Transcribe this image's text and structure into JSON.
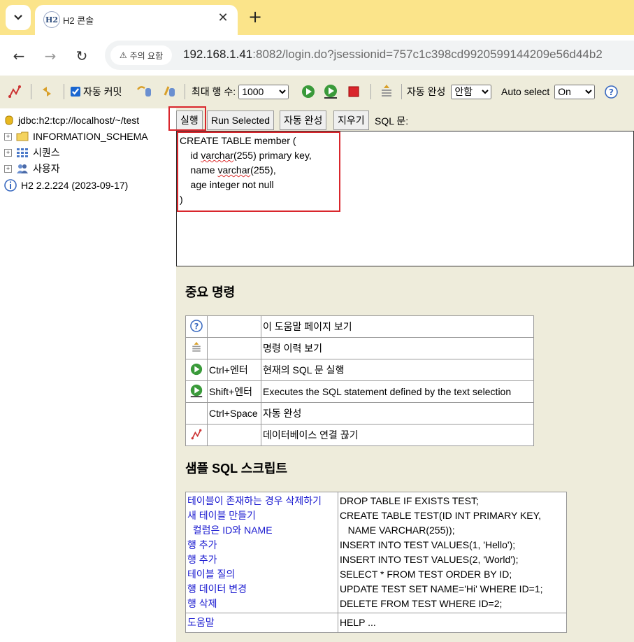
{
  "browser": {
    "tab_title": "H2 콘솔",
    "tab_logo": "H2",
    "security_chip": "주의 요함",
    "url_host": "192.168.1.41",
    "url_rest": ":8082/login.do?jsessionid=757c1c398cd9920599144209e56d44b2"
  },
  "toolbar": {
    "auto_commit_label": "자동 커밋",
    "auto_commit_checked": true,
    "max_rows_label": "최대 행 수:",
    "max_rows_value": "1000",
    "autocomplete_label": "자동 완성",
    "autocomplete_value": "안함",
    "auto_select_label": "Auto select",
    "auto_select_value": "On"
  },
  "tree": {
    "connection": "jdbc:h2:tcp://localhost/~/test",
    "items": [
      "INFORMATION_SCHEMA",
      "시퀀스",
      "사용자"
    ],
    "version": "H2 2.2.224 (2023-09-17)"
  },
  "query": {
    "run_label": "실행",
    "run_selected_label": "Run Selected",
    "autocomplete_label": "자동 완성",
    "clear_label": "지우기",
    "sql_label": "SQL 문:",
    "sql_lines": [
      "CREATE TABLE member (",
      "    id varchar(255) primary key,",
      "    name varchar(255),",
      "    age integer not null",
      ")"
    ]
  },
  "help": {
    "title": "중요 명령",
    "rows": [
      {
        "icon": "help-icon",
        "key": "",
        "desc": "이 도움말 페이지 보기"
      },
      {
        "icon": "history-icon",
        "key": "",
        "desc": "명령 이력 보기"
      },
      {
        "icon": "run-icon",
        "key": "Ctrl+엔터",
        "desc": "현재의 SQL 문 실행"
      },
      {
        "icon": "run-selected-icon",
        "key": "Shift+엔터",
        "desc": "Executes the SQL statement defined by the text selection"
      },
      {
        "icon": "",
        "key": "Ctrl+Space",
        "desc": "자동 완성"
      },
      {
        "icon": "disconnect-icon",
        "key": "",
        "desc": "데이터베이스 연결 끊기"
      }
    ]
  },
  "samples": {
    "title": "샘플 SQL 스크립트",
    "links": [
      "테이블이 존재하는 경우 삭제하기",
      "새 테이블 만들기",
      "  컬럼은 ID와 NAME",
      "행 추가",
      "행 추가",
      "테이블 질의",
      "행 데이터 변경",
      "행 삭제"
    ],
    "code": [
      "DROP TABLE IF EXISTS TEST;",
      "CREATE TABLE TEST(ID INT PRIMARY KEY,",
      "   NAME VARCHAR(255));",
      "INSERT INTO TEST VALUES(1, 'Hello');",
      "INSERT INTO TEST VALUES(2, 'World');",
      "SELECT * FROM TEST ORDER BY ID;",
      "UPDATE TEST SET NAME='Hi' WHERE ID=1;",
      "DELETE FROM TEST WHERE ID=2;"
    ],
    "help_link": "도움말",
    "help_code": "HELP ..."
  },
  "colors": {
    "panel": "#eeecdb",
    "tabstrip": "#fbe48a",
    "highlight": "#d9262c",
    "link": "#1a1ad0"
  }
}
